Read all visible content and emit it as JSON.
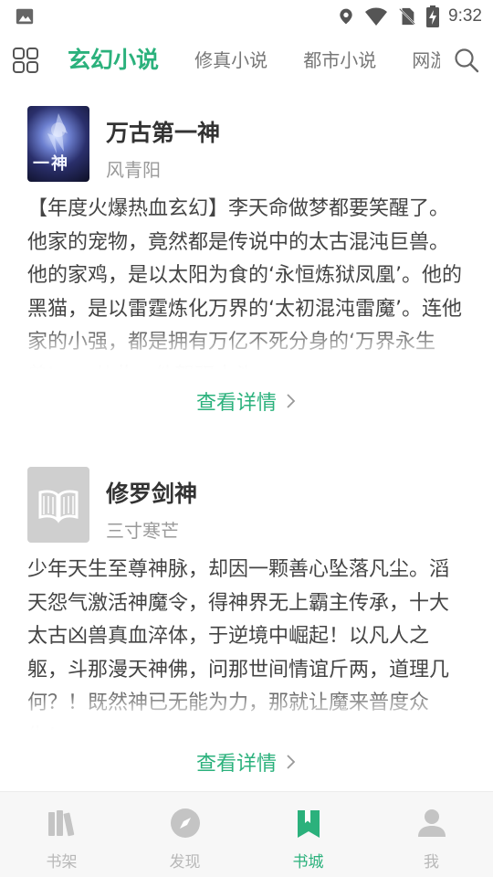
{
  "status_bar": {
    "time": "9:32",
    "icons": [
      "image-icon",
      "location-icon",
      "wifi-icon",
      "no-sim-icon",
      "battery-charging-icon"
    ]
  },
  "top_bar": {
    "tabs": [
      {
        "label": "玄幻小说",
        "active": true
      },
      {
        "label": "修真小说",
        "active": false
      },
      {
        "label": "都市小说",
        "active": false
      },
      {
        "label": "网游小说",
        "active": false
      }
    ]
  },
  "books": [
    {
      "title": "万古第一神",
      "author": "风青阳",
      "cover": "art",
      "cover_text": "一神",
      "description": "【年度火爆热血玄幻】李天命做梦都要笑醒了。他家的宠物，竟然都是传说中的太古混沌巨兽。他的家鸡，是以太阳为食的‘永恒炼狱凤凰’。他的黑猫，是以雷霆炼化万界的‘太初混沌雷魔’。连他家的小强，都是拥有万亿不死分身的‘万界永生兽’……从此，他驾驭十头……",
      "more_label": "查看详情"
    },
    {
      "title": "修罗剑神",
      "author": "三寸寒芒",
      "cover": "placeholder",
      "cover_text": "",
      "description": "少年天生至尊神脉，却因一颗善心坠落凡尘。滔天怨气激活神魔令，得神界无上霸主传承，十大太古凶兽真血淬体，于逆境中崛起！以凡人之躯，斗那漫天神佛，问那世间情谊斤两，道理几何？！既然神已无能为力，那就让魔来普度众生！",
      "more_label": "查看详情"
    }
  ],
  "bottom_nav": [
    {
      "label": "书架",
      "icon": "bookshelf-icon",
      "active": false
    },
    {
      "label": "发现",
      "icon": "compass-icon",
      "active": false
    },
    {
      "label": "书城",
      "icon": "bookstore-icon",
      "active": true
    },
    {
      "label": "我",
      "icon": "profile-icon",
      "active": false
    }
  ],
  "colors": {
    "accent": "#2bb17c",
    "inactive": "#b8b8b8",
    "text": "#333333"
  }
}
